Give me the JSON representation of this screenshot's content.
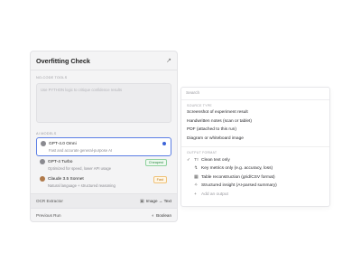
{
  "card": {
    "title": "Overfitting Check",
    "no_code_label": "NO-CODE TOOLS",
    "prompt_placeholder": "Use PYTHON logic to critique confidence results",
    "ai_models_label": "AI MODELS",
    "models": [
      {
        "name": "GPT-4.0 Omni",
        "desc": "Fast and accurate general-purpose AI",
        "selected": true
      },
      {
        "name": "GPT-4 Turbo",
        "desc": "Optimized for speed, lower API usage",
        "badge": "Cheapest"
      },
      {
        "name": "Claude 3.5 Sonnet",
        "desc": "Natural language + structured reasoning",
        "badge": "Fast"
      }
    ],
    "ocr": {
      "label": "OCR Extractor",
      "value": "Image → Text"
    },
    "previous": {
      "label": "Previous Run",
      "value": "Boolean"
    }
  },
  "dropdown": {
    "search_placeholder": "Search",
    "source_label": "SOURCE TYPE",
    "sources": [
      "Screenshot of experiment result",
      "Handwritten notes (scan or tablet)",
      "PDF (attached to this run)",
      "Diagram or whiteboard image"
    ],
    "output_label": "OUTPUT FORMAT",
    "outputs": [
      {
        "label": "Clean text only",
        "checked": true
      },
      {
        "label": "Key metrics only (e.g. accuracy, loss)"
      },
      {
        "label": "Table reconstruction (grid/CSV format)"
      },
      {
        "label": "Structured insight (AI-parsed summary)"
      }
    ],
    "add_output": "Add an output"
  }
}
